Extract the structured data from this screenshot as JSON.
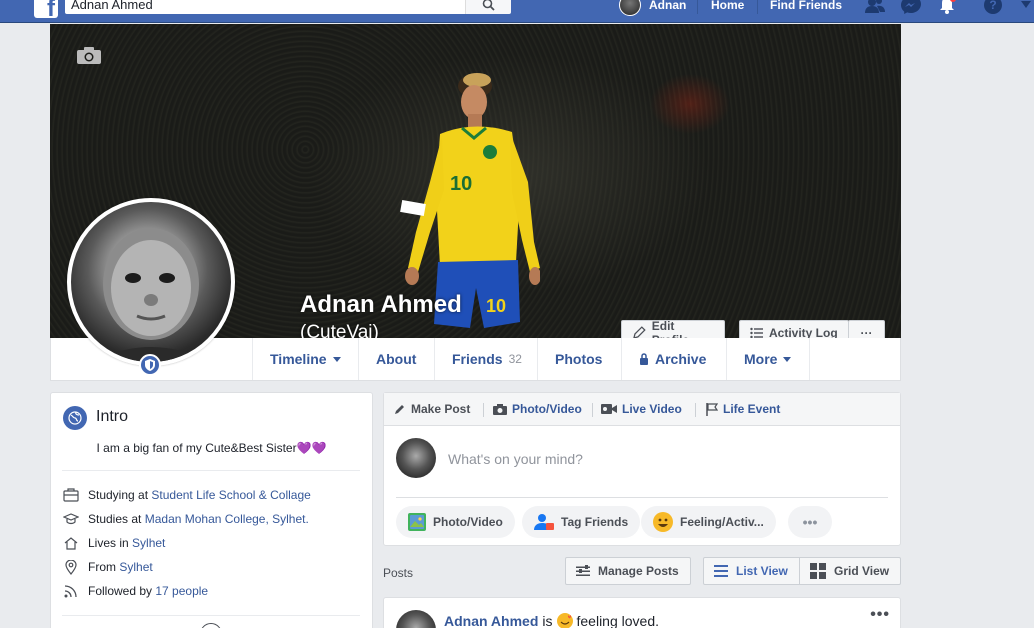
{
  "topbar": {
    "search_value": "Adnan Ahmed",
    "user_name": "Adnan",
    "home_label": "Home",
    "find_friends_label": "Find Friends"
  },
  "cover": {
    "name": "Adnan Ahmed",
    "alternate_name": "(CuteVai)",
    "edit_profile_label": "Edit Profile",
    "activity_log_label": "Activity Log",
    "more_label": "···"
  },
  "nav": {
    "tabs": [
      {
        "label": "Timeline",
        "dropdown": true
      },
      {
        "label": "About"
      },
      {
        "label": "Friends",
        "count": "32"
      },
      {
        "label": "Photos"
      },
      {
        "label": "Archive"
      },
      {
        "label": "More",
        "dropdown": true
      }
    ]
  },
  "intro": {
    "title": "Intro",
    "bio": "I am a big fan of my Cute&Best Sister💜💜",
    "rows": [
      {
        "prefix": "Studying at",
        "link": "Student Life School & Collage",
        "icon": "briefcase-icon"
      },
      {
        "prefix": "Studies at",
        "link": "Madan Mohan College, Sylhet.",
        "icon": "graduation-cap-icon"
      },
      {
        "prefix": "Lives in",
        "link": "Sylhet",
        "icon": "home-icon"
      },
      {
        "prefix": "From",
        "link": "Sylhet",
        "icon": "location-pin-icon"
      },
      {
        "prefix": "Followed by",
        "link": "17 people",
        "icon": "rss-icon"
      }
    ]
  },
  "composer": {
    "tabs": [
      "Make Post",
      "Photo/Video",
      "Live Video",
      "Life Event"
    ],
    "placeholder": "What's on your mind?",
    "actions": [
      "Photo/Video",
      "Tag Friends",
      "Feeling/Activ...",
      "•••"
    ]
  },
  "posts_header": {
    "label": "Posts",
    "manage_label": "Manage Posts",
    "list_view_label": "List View",
    "grid_view_label": "Grid View"
  },
  "post": {
    "author": "Adnan Ahmed",
    "is_text": "is",
    "feeling": "feeling loved.",
    "more": "•••"
  },
  "colors": {
    "brand": "#4267b2",
    "link": "#365899",
    "background": "#e9ebee"
  }
}
